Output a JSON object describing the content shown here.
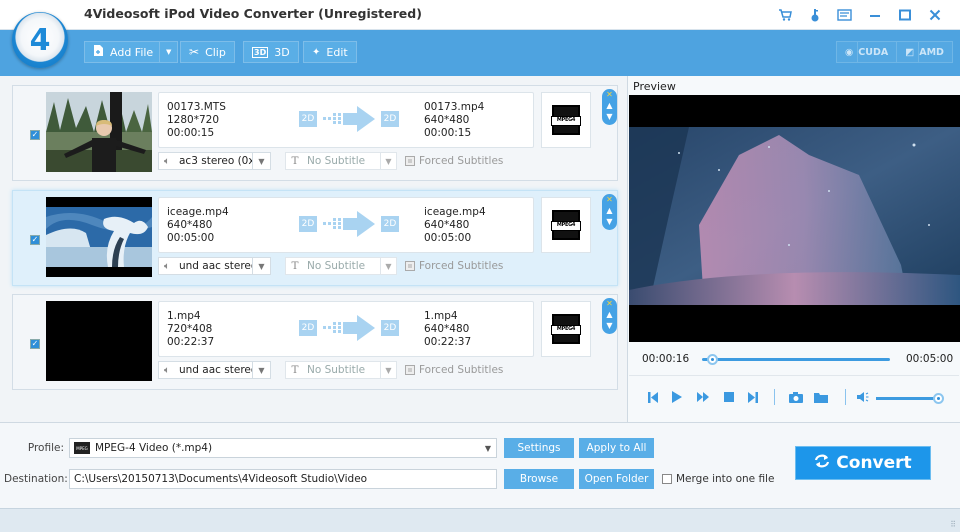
{
  "window": {
    "title": "4Videosoft iPod Video Converter (Unregistered)",
    "logo_glyph": "4",
    "title_icons": [
      "cart-icon",
      "key-icon",
      "feedback-icon",
      "minimize-icon",
      "maximize-icon",
      "close-icon"
    ]
  },
  "toolbar": {
    "add_file": "Add File",
    "clip": "Clip",
    "three_d": "3D",
    "edit": "Edit",
    "cuda": "CUDA",
    "amd": "AMD"
  },
  "files": [
    {
      "checked": true,
      "source": {
        "name": "00173.MTS",
        "resolution": "1280*720",
        "duration": "00:00:15"
      },
      "output": {
        "name": "00173.mp4",
        "resolution": "640*480",
        "duration": "00:00:15"
      },
      "mode_in": "2D",
      "mode_out": "2D",
      "audio": "ac3 stereo (0x",
      "subtitle": "No Subtitle",
      "forced_subtitles": "Forced Subtitles",
      "format_badge": "MPEG4",
      "selected": false
    },
    {
      "checked": true,
      "source": {
        "name": "iceage.mp4",
        "resolution": "640*480",
        "duration": "00:05:00"
      },
      "output": {
        "name": "iceage.mp4",
        "resolution": "640*480",
        "duration": "00:05:00"
      },
      "mode_in": "2D",
      "mode_out": "2D",
      "audio": "und aac stereo",
      "subtitle": "No Subtitle",
      "forced_subtitles": "Forced Subtitles",
      "format_badge": "MPEG4",
      "selected": true
    },
    {
      "checked": true,
      "source": {
        "name": "1.mp4",
        "resolution": "720*408",
        "duration": "00:22:37"
      },
      "output": {
        "name": "1.mp4",
        "resolution": "640*480",
        "duration": "00:22:37"
      },
      "mode_in": "2D",
      "mode_out": "2D",
      "audio": "und aac stereo",
      "subtitle": "No Subtitle",
      "forced_subtitles": "Forced Subtitles",
      "format_badge": "MPEG4",
      "selected": false
    }
  ],
  "preview": {
    "label": "Preview",
    "current_time": "00:00:16",
    "total_time": "00:05:00",
    "progress_fraction": 0.053,
    "volume_fraction": 1.0
  },
  "bottom": {
    "profile_label": "Profile:",
    "profile_value": "MPEG-4 Video (*.mp4)",
    "destination_label": "Destination:",
    "destination_value": "C:\\Users\\20150713\\Documents\\4Videosoft Studio\\Video",
    "settings": "Settings",
    "apply_to_all": "Apply to All",
    "browse": "Browse",
    "open_folder": "Open Folder",
    "merge_label": "Merge into one file",
    "merge_checked": false,
    "convert": "Convert"
  },
  "colors": {
    "accent": "#4ea3e0",
    "convert": "#1d96ea",
    "button": "#59aee7"
  }
}
